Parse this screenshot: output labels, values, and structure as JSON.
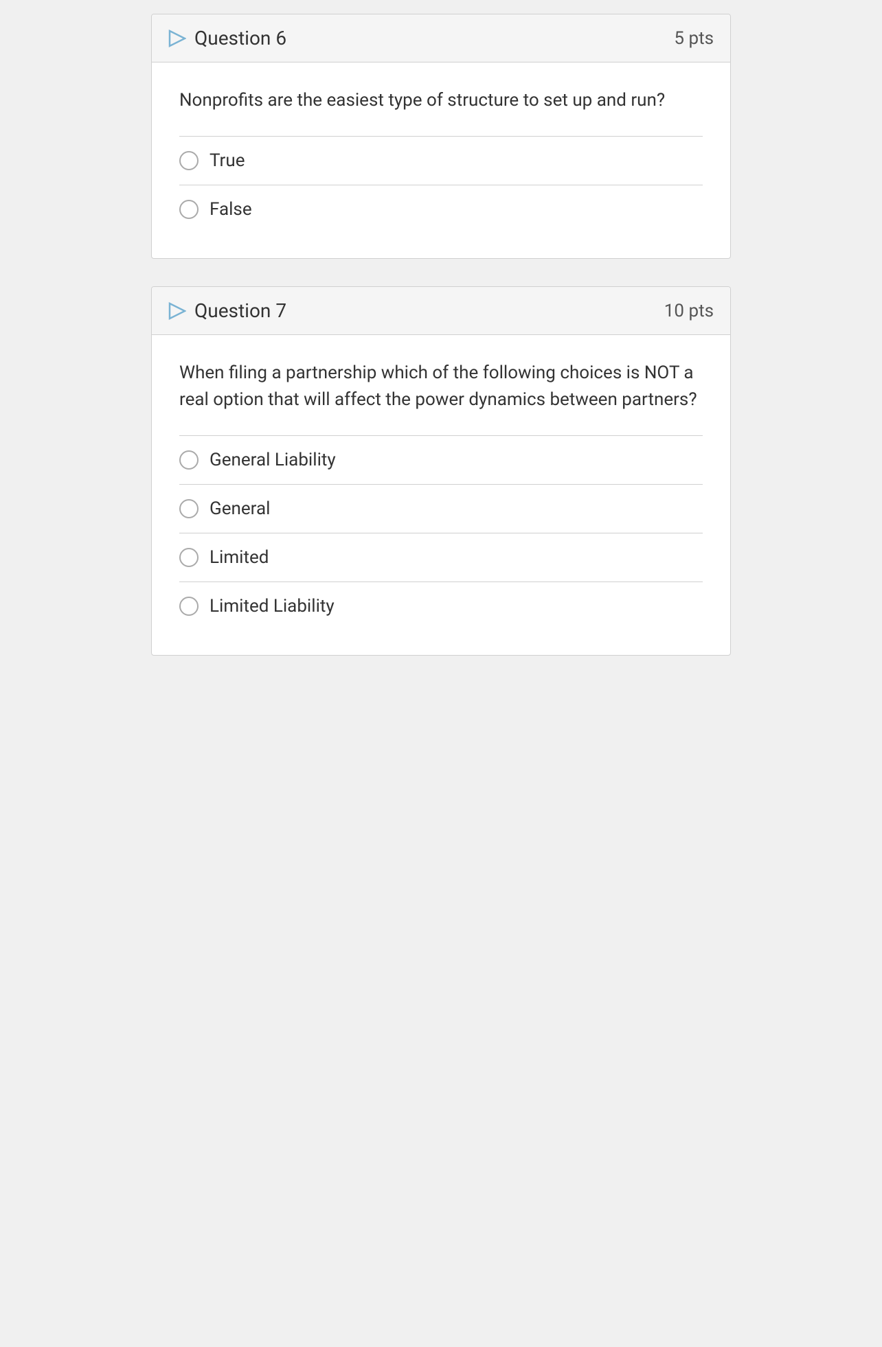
{
  "question6": {
    "title": "Question 6",
    "pts": "5 pts",
    "text": "Nonprofits are the easiest type of structure to set up and run?",
    "options": [
      {
        "id": "q6-true",
        "label": "True"
      },
      {
        "id": "q6-false",
        "label": "False"
      }
    ]
  },
  "question7": {
    "title": "Question 7",
    "pts": "10 pts",
    "text": "When filing a partnership which of the following choices is NOT a real option that will affect the power dynamics between partners?",
    "options": [
      {
        "id": "q7-general-liability",
        "label": "General Liability"
      },
      {
        "id": "q7-general",
        "label": "General"
      },
      {
        "id": "q7-limited",
        "label": "Limited"
      },
      {
        "id": "q7-limited-liability",
        "label": "Limited Liability"
      }
    ]
  }
}
